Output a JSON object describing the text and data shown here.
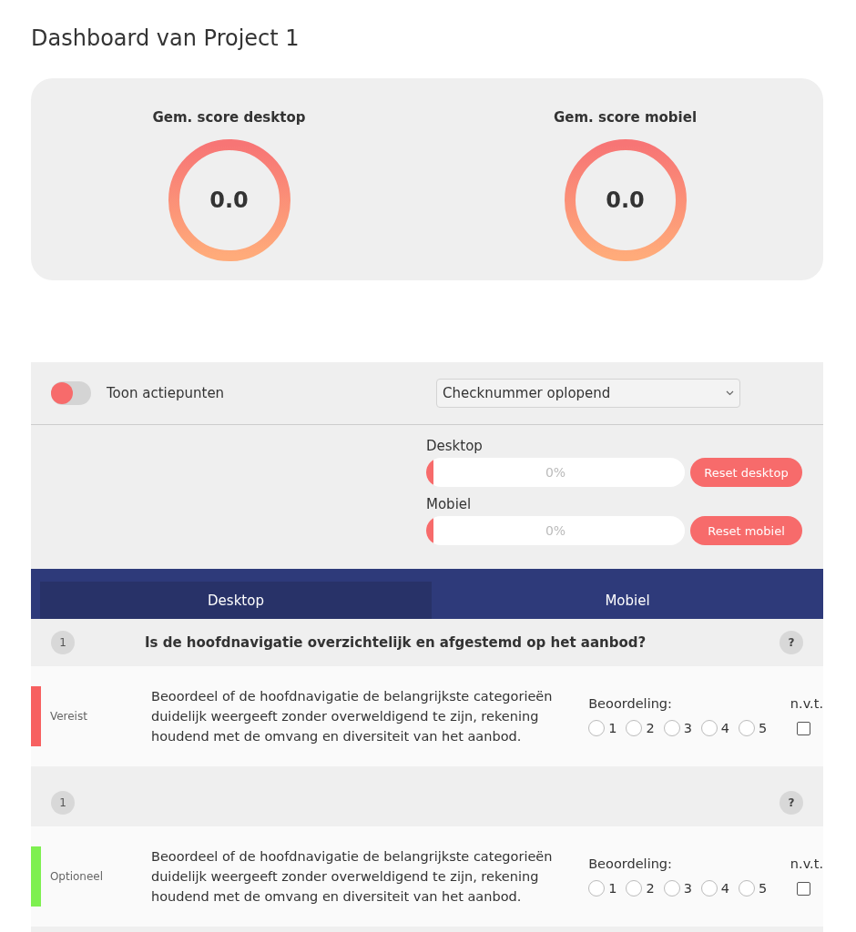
{
  "title": "Dashboard van Project 1",
  "scores": [
    {
      "label": "Gem. score desktop",
      "value": "0.0"
    },
    {
      "label": "Gem. score mobiel",
      "value": "0.0"
    }
  ],
  "filters": {
    "toggle": {
      "label": "Toon actiepunten",
      "on": false
    },
    "sort": {
      "value": "Checknummer oplopend"
    }
  },
  "progress": [
    {
      "label": "Desktop",
      "level": 0,
      "reading": "0%",
      "button": "Reset desktop"
    },
    {
      "label": "Mobiel",
      "level": 0,
      "reading": "0%",
      "button": "Reset mobiel"
    }
  ],
  "tabs": [
    {
      "label": "Desktop",
      "selected": true
    },
    {
      "label": "Mobiel",
      "selected": false
    }
  ],
  "checks": [
    {
      "number": "1",
      "question": "Is de hoofdnavigatie overzichtelijk en afgestemd op het aanbod?",
      "help": "?",
      "requirement": "Vereist",
      "color": "#f76060",
      "description": "Beoordeel of de hoofdnavigatie de belangrijkste categorieën duidelijk weergeeft zonder overweldigend te zijn, rekening houdend met de omvang en diversiteit van het aanbod.",
      "rating_label": "Beoordeling:",
      "options": [
        {
          "label": "1",
          "selected": false
        },
        {
          "label": "2",
          "selected": false
        },
        {
          "label": "3",
          "selected": false
        },
        {
          "label": "4",
          "selected": false
        },
        {
          "label": "5",
          "selected": false
        }
      ],
      "na_label": "n.v.t.",
      "na_checked": false
    },
    {
      "number": "1",
      "help": "?",
      "requirement": "Optioneel",
      "color": "#7ef050",
      "description": "Beoordeel of de hoofdnavigatie de belangrijkste categorieën duidelijk weergeeft zonder overweldigend te zijn, rekening houdend met de omvang en diversiteit van het aanbod.",
      "rating_label": "Beoordeling:",
      "options": [
        {
          "label": "1",
          "selected": false
        },
        {
          "label": "2",
          "selected": false
        },
        {
          "label": "3",
          "selected": false
        },
        {
          "label": "4",
          "selected": false
        },
        {
          "label": "5",
          "selected": false
        }
      ],
      "na_label": "n.v.t.",
      "na_checked": false
    }
  ]
}
